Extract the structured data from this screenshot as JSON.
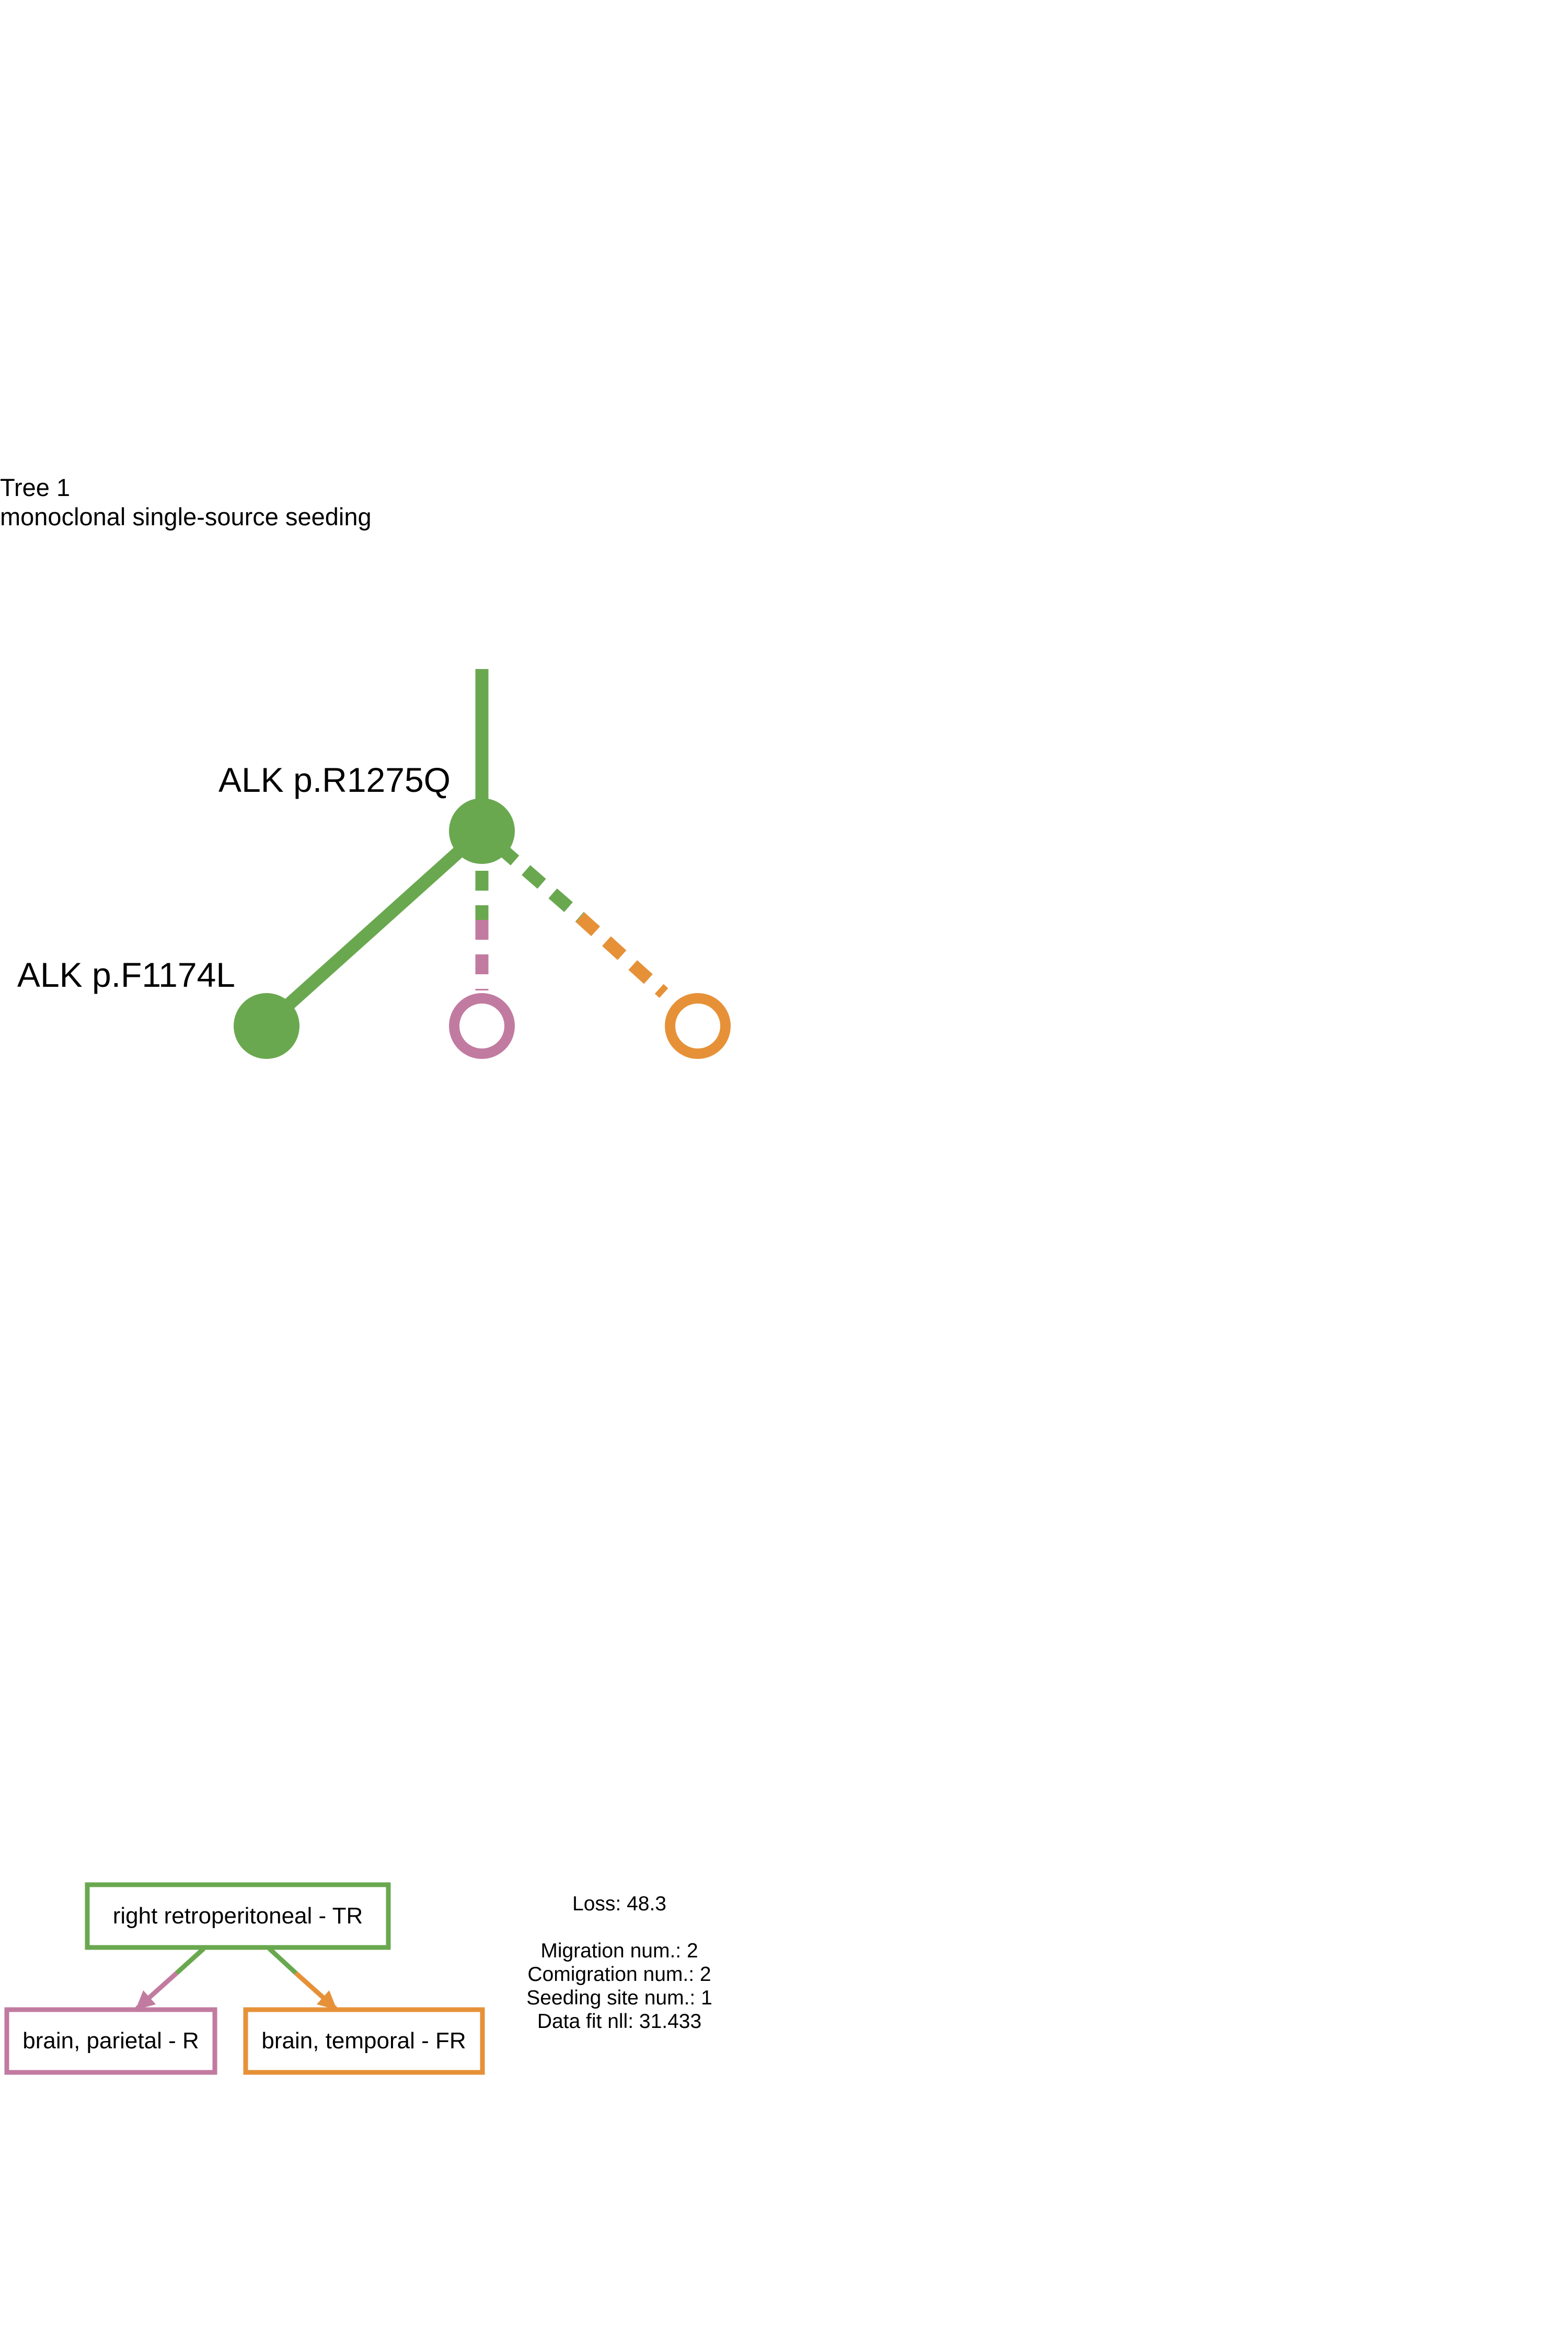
{
  "header": {
    "title": "Tree 1",
    "subtitle": "monoclonal single-source seeding"
  },
  "clone_tree": {
    "nodes": [
      {
        "id": "root",
        "label": "ALK p.R1275Q",
        "site": "right retroperitoneal - TR",
        "filled": true
      },
      {
        "id": "child_left",
        "label": "ALK p.F1174L",
        "site": "right retroperitoneal - TR",
        "filled": true
      },
      {
        "id": "child_parietal",
        "label": "",
        "site": "brain, parietal - R",
        "filled": false
      },
      {
        "id": "child_temporal",
        "label": "",
        "site": "brain, temporal - FR",
        "filled": false
      }
    ],
    "edges": [
      {
        "from": "root",
        "to": "child_left",
        "style": "solid"
      },
      {
        "from": "root",
        "to": "child_parietal",
        "style": "dashed",
        "migration": true
      },
      {
        "from": "root",
        "to": "child_temporal",
        "style": "dashed",
        "migration": true
      }
    ]
  },
  "migration_graph": {
    "sites": [
      {
        "id": "primary",
        "label": "right retroperitoneal - TR"
      },
      {
        "id": "parietal",
        "label": "brain, parietal - R"
      },
      {
        "id": "temporal",
        "label": "brain, temporal - FR"
      }
    ],
    "migrations": [
      {
        "from": "right retroperitoneal - TR",
        "to": "brain, parietal - R"
      },
      {
        "from": "right retroperitoneal - TR",
        "to": "brain, temporal - FR"
      }
    ]
  },
  "stats": {
    "loss": "Loss: 48.3",
    "migration": "Migration num.: 2",
    "comigration": "Comigration num.: 2",
    "seeding": "Seeding site num.: 1",
    "datafit": "Data fit nll: 31.433"
  },
  "colors": {
    "primary": "#6aa84f",
    "parietal": "#c27ba0",
    "temporal": "#e69138"
  }
}
